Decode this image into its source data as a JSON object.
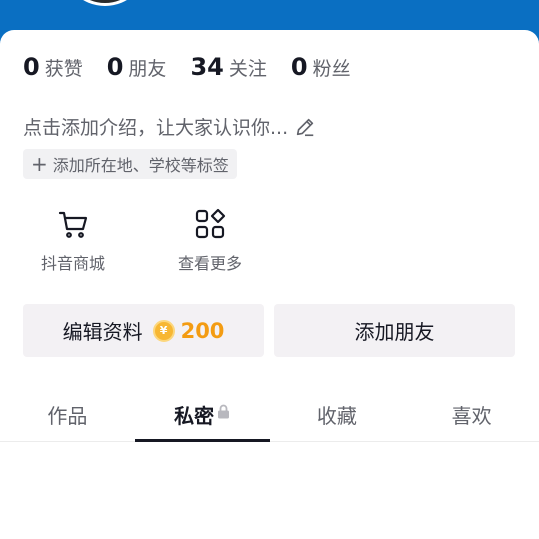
{
  "stats": [
    {
      "value": "0",
      "label": "获赞"
    },
    {
      "value": "0",
      "label": "朋友"
    },
    {
      "value": "34",
      "label": "关注"
    },
    {
      "value": "0",
      "label": "粉丝"
    }
  ],
  "bio": {
    "text": "点击添加介绍，让大家认识你..."
  },
  "tag_chip": {
    "text": "添加所在地、学校等标签"
  },
  "shortcuts": [
    {
      "label": "抖音商城",
      "icon": "cart-icon"
    },
    {
      "label": "查看更多",
      "icon": "apps-grid-icon"
    }
  ],
  "buttons": {
    "edit_profile": "编辑资料",
    "coin_symbol": "¥",
    "coin_count": "200",
    "add_friends": "添加朋友"
  },
  "tabs": [
    {
      "label": "作品",
      "active": false
    },
    {
      "label": "私密",
      "active": true
    },
    {
      "label": "收藏",
      "active": false
    },
    {
      "label": "喜欢",
      "active": false
    }
  ],
  "colors": {
    "header_blue": "#0a6fc2",
    "coin_gold": "#f39c12",
    "text_primary": "#161823",
    "text_secondary": "#61636b"
  }
}
